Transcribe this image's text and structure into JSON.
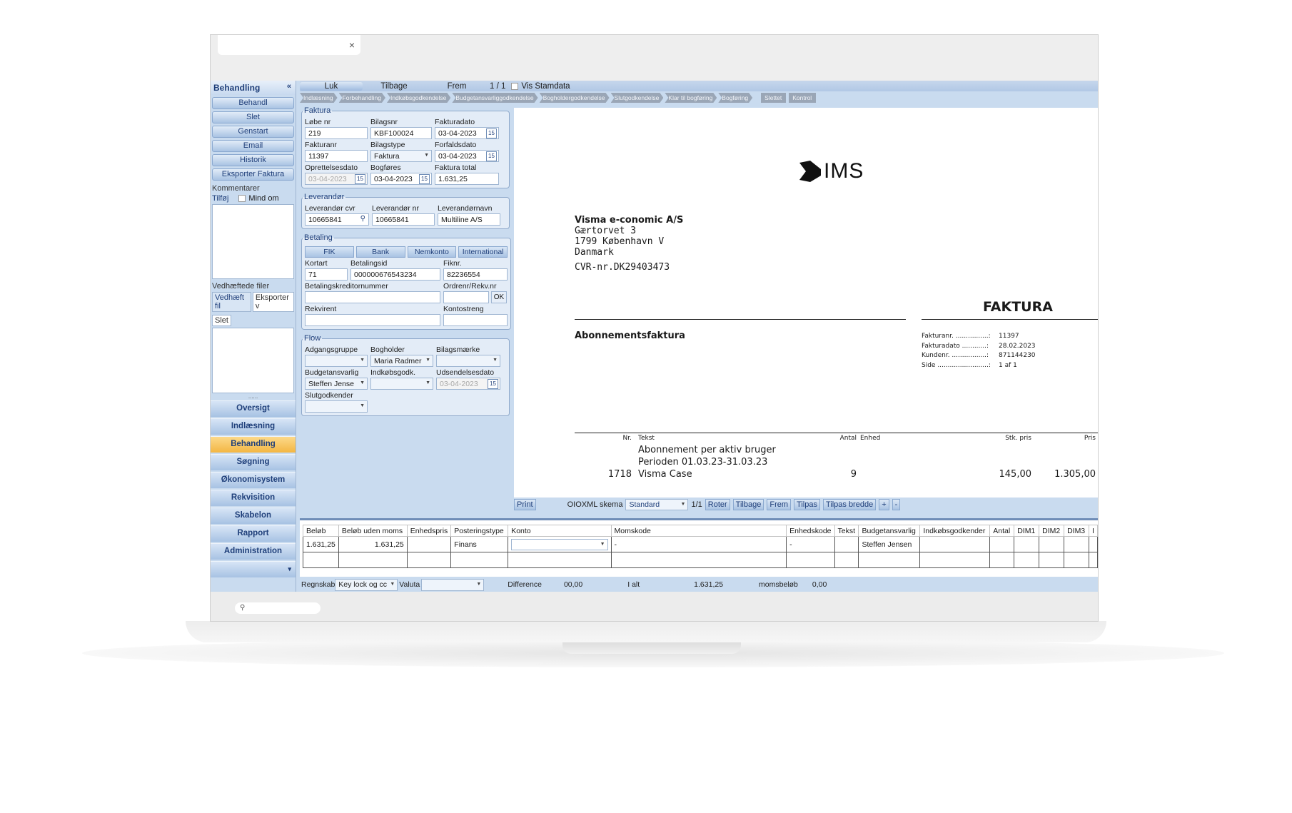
{
  "browser": {
    "close_icon": "×"
  },
  "sidebar": {
    "title": "Behandling",
    "collapse_icon": "«",
    "buttons": [
      "Behandl",
      "Slet",
      "Genstart",
      "Email",
      "Historik",
      "Eksporter Faktura"
    ],
    "comments_label": "Kommentarer",
    "add_label": "Tilføj",
    "remind_label": "Mind om",
    "attached_label": "Vedhæftede filer",
    "attach_tab": "Vedhæft fil",
    "export_tab": "Eksporter v",
    "delete_label": "Slet",
    "grip": "......",
    "nav": [
      "Oversigt",
      "Indlæsning",
      "Behandling",
      "Søgning",
      "Økonomisystem",
      "Rekvisition",
      "Skabelon",
      "Rapport",
      "Administration"
    ],
    "nav_active": "Behandling",
    "nav_more": "▾"
  },
  "toolbar": {
    "close": "Luk",
    "back": "Tilbage",
    "next": "Frem",
    "page": "1 / 1",
    "show_master": "Vis Stamdata"
  },
  "flow": {
    "steps": [
      "Indlæsning",
      "Forbehandling",
      "Indkøbsgodkendelse",
      "Budgetansvarliggodkendelse",
      "Bogholdergodkendelse",
      "Slutgodkendelse",
      "Klar til bogføring",
      "Bogføring"
    ],
    "extra": [
      "Slettet",
      "Kontrol"
    ]
  },
  "faktura": {
    "legend": "Faktura",
    "lobe_label": "Løbe nr",
    "lobe": "219",
    "bilagsnr_label": "Bilagsnr",
    "bilagsnr": "KBF100024",
    "fakturadato_label": "Fakturadato",
    "fakturadato": "03-04-2023",
    "fakturanr_label": "Fakturanr",
    "fakturanr": "11397",
    "bilagstype_label": "Bilagstype",
    "bilagstype": "Faktura",
    "forfaldsdato_label": "Forfaldsdato",
    "forfaldsdato": "03-04-2023",
    "oprettelse_label": "Oprettelsesdato",
    "oprettelse": "03-04-2023",
    "bogfores_label": "Bogføres",
    "bogfores": "03-04-2023",
    "total_label": "Faktura total",
    "total": "1.631,25",
    "cal": "15"
  },
  "leverandor": {
    "legend": "Leverandør",
    "cvr_label": "Leverandør cvr",
    "cvr": "10665841",
    "nr_label": "Leverandør nr",
    "nr": "10665841",
    "navn_label": "Leverandørnavn",
    "navn": "Multiline A/S"
  },
  "betaling": {
    "legend": "Betaling",
    "tabs": [
      "FIK",
      "Bank",
      "Nemkonto",
      "International"
    ],
    "kortart_label": "Kortart",
    "kortart": "71",
    "betalingsid_label": "Betalingsid",
    "betalingsid": "000000676543234",
    "fiknr_label": "Fiknr.",
    "fiknr": "82236554",
    "kreditor_label": "Betalingskreditornummer",
    "ordrenr_label": "Ordrenr/Rekv.nr",
    "ok": "OK",
    "rekvirent_label": "Rekvirent",
    "kontostreng_label": "Kontostreng"
  },
  "flowgrp": {
    "legend": "Flow",
    "adgang_label": "Adgangsgruppe",
    "bogholder_label": "Bogholder",
    "bogholder": "Maria Radmer",
    "bilagsmaerke_label": "Bilagsmærke",
    "budget_label": "Budgetansvarlig",
    "budget": "Steffen Jense",
    "indkob_label": "Indkøbsgodk.",
    "udsend_label": "Udsendelsesdato",
    "udsend": "03-04-2023",
    "slut_label": "Slutgodkender"
  },
  "invoice": {
    "logo": "IMS",
    "company": "Visma e-conomic A/S",
    "address": [
      "Gærtorvet 3",
      "1799 København V",
      "Danmark"
    ],
    "cvr": "CVR-nr.DK29403473",
    "title": "FAKTURA",
    "subtitle": "Abonnementsfaktura",
    "meta": [
      {
        "k": "Fakturanr. ................:",
        "v": "11397"
      },
      {
        "k": "Fakturadato ............:",
        "v": "28.02.2023"
      },
      {
        "k": "Kundenr. .................:",
        "v": "871144230"
      },
      {
        "k": "Side .........................:",
        "v": "1 af 1"
      }
    ],
    "headers": {
      "nr": "Nr.",
      "tekst": "Tekst",
      "antal": "Antal",
      "enhed": "Enhed",
      "stk": "Stk. pris",
      "pris": "Pris"
    },
    "desc1": "Abonnement per aktiv bruger",
    "desc2": "Perioden 01.03.23-31.03.23",
    "line": {
      "nr": "1718",
      "tekst": "Visma Case",
      "antal": "9",
      "stk": "145,00",
      "pris": "1.305,00"
    }
  },
  "viewer_tools": {
    "print": "Print",
    "oioxml_label": "OIOXML skema",
    "oioxml": "Standard",
    "page": "1/1",
    "buttons": [
      "Roter",
      "Tilbage",
      "Frem",
      "Tilpas",
      "Tilpas bredde",
      "+",
      "-"
    ]
  },
  "grid": {
    "headers": [
      "Beløb",
      "Beløb uden moms",
      "Enhedspris",
      "Posteringstype",
      "Konto",
      "Momskode",
      "Enhedskode",
      "Tekst",
      "Budgetansvarlig",
      "Indkøbsgodkender",
      "Antal",
      "DIM1",
      "DIM2",
      "DIM3",
      "I"
    ],
    "row": [
      "1.631,25",
      "1.631,25",
      "",
      "Finans",
      "",
      "-",
      "-",
      "",
      "Steffen Jensen",
      "",
      "",
      "",
      "",
      "",
      ""
    ]
  },
  "bottom": {
    "regnskab_label": "Regnskab",
    "regnskab": "Key lock og cc",
    "valuta_label": "Valuta",
    "difference_label": "Difference",
    "difference": "00,00",
    "ialt_label": "I alt",
    "ialt": "1.631,25",
    "moms_label": "momsbeløb",
    "moms": "0,00"
  },
  "colors": {
    "accent": "#f3b643",
    "panel": "#c9dbef",
    "brand": "#1f3f7a"
  }
}
